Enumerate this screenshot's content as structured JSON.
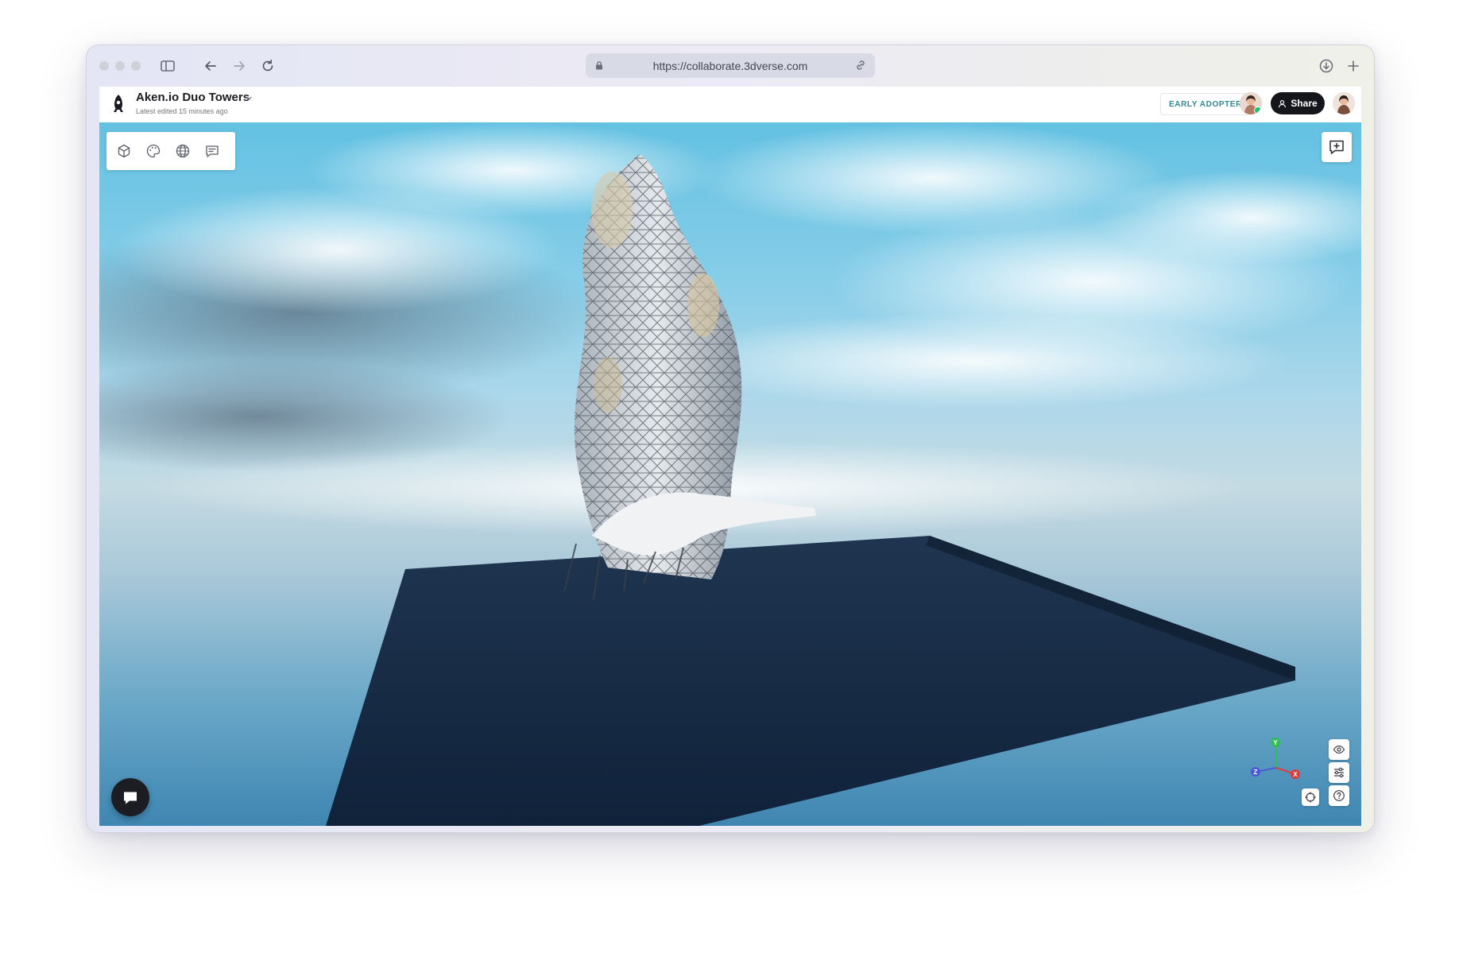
{
  "browser": {
    "url": "https://collaborate.3dverse.com",
    "icons": [
      "sidebar-toggle-icon",
      "back-arrow-icon",
      "forward-arrow-icon",
      "reload-icon",
      "lock-icon",
      "link-icon",
      "download-icon",
      "new-tab-plus-icon"
    ]
  },
  "header": {
    "project_title": "Aken.io Duo Towers",
    "last_edited": "Latest edited 15 minutes ago",
    "badge": "EARLY ADOPTER",
    "share_label": "Share"
  },
  "toolbar": {
    "tools": [
      "cube-icon",
      "palette-icon",
      "globe-icon",
      "comment-icon"
    ]
  },
  "viewport": {
    "gizmo_axes": [
      "Y",
      "Z",
      "X"
    ],
    "axis_colors": {
      "Y": "#2fbf57",
      "Z": "#4b5bd6",
      "X": "#e23b3b"
    }
  },
  "colors": {
    "accent": "#2f8a98",
    "dark_button": "#14161c",
    "online_status": "#23c16b"
  }
}
